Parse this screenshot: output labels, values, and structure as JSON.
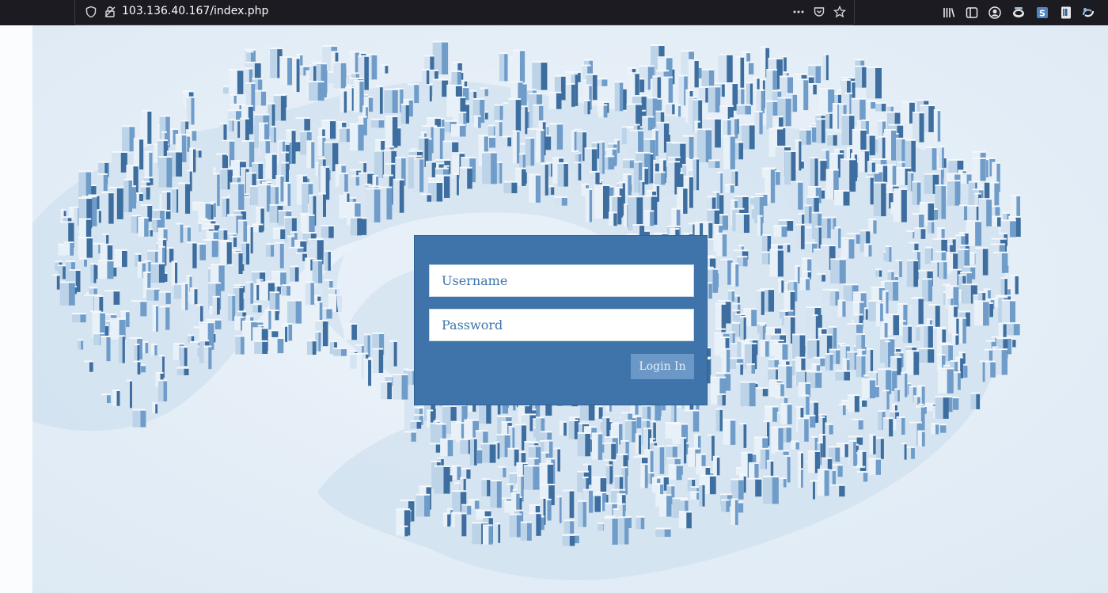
{
  "browser": {
    "url": "103.136.40.167/index.php",
    "toolbar_icons": [
      "shield-icon",
      "connection-icon",
      "more-icon",
      "pocket-icon",
      "bookmark-star-icon",
      "library-icon",
      "sidebar-icon",
      "account-icon",
      "extension-icon",
      "extension-s-icon",
      "extension-reader-icon",
      "extension-sync-icon"
    ]
  },
  "background": {
    "description_icon": "city-illustration",
    "colors": {
      "sky": "#e6eff7",
      "building_light": "#e8f0f8",
      "building_mid": "#8fb3d6",
      "building_dark": "#3d6e9f"
    }
  },
  "login": {
    "username_placeholder": "Username",
    "password_placeholder": "Password",
    "submit_label": "Login In",
    "colors": {
      "panel": "#3f74aa",
      "button": "#6b98c6",
      "field_text": "#3f74aa"
    }
  }
}
